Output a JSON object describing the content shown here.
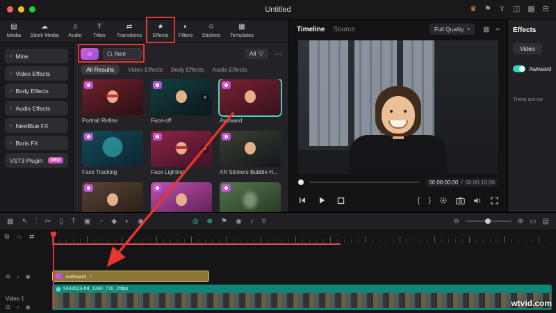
{
  "colors": {
    "accent": "#2ed9c3",
    "annotation": "#e8352c",
    "selection": "#45d7c6",
    "badge_pink": "#d553c8",
    "effect_clip": "#8c7634",
    "video_clip": "#0e8576"
  },
  "titlebar": {
    "title": "Untitled",
    "right_icons": [
      {
        "name": "upgrade-crown-icon",
        "glyph": "♛"
      },
      {
        "name": "flag-icon",
        "glyph": "⚑"
      },
      {
        "name": "export-icon",
        "glyph": "⇧"
      },
      {
        "name": "layout-icon",
        "glyph": "◫"
      },
      {
        "name": "media-grid-icon",
        "glyph": "▦"
      },
      {
        "name": "screen-record-icon",
        "glyph": "⊟"
      }
    ]
  },
  "ribbon": {
    "tabs": [
      {
        "label": "Media",
        "glyph": "▤"
      },
      {
        "label": "Stock Media",
        "glyph": "☁"
      },
      {
        "label": "Audio",
        "glyph": "♫"
      },
      {
        "label": "Titles",
        "glyph": "T"
      },
      {
        "label": "Transitions",
        "glyph": "⇄"
      },
      {
        "label": "Effects",
        "glyph": "★"
      },
      {
        "label": "Filters",
        "glyph": "◐"
      },
      {
        "label": "Stickers",
        "glyph": "☺"
      },
      {
        "label": "Templates",
        "glyph": "▦"
      }
    ]
  },
  "sidebar": {
    "chevron": "›",
    "items": [
      {
        "label": "Mine"
      },
      {
        "label": "Video Effects"
      },
      {
        "label": "Body Effects"
      },
      {
        "label": "Audio Effects"
      },
      {
        "label": "NewBlue FX"
      },
      {
        "label": "Boris FX"
      },
      {
        "label": "VST3 Plugin",
        "badge": "PRO"
      }
    ]
  },
  "browser": {
    "search": {
      "value": "face"
    },
    "all_filter": {
      "label": "All",
      "glyph": "▽"
    },
    "more_glyph": "⋯",
    "face_button_glyph": "☺",
    "plus_glyph": "+",
    "chips": [
      {
        "label": "All Results"
      },
      {
        "label": "Video Effects"
      },
      {
        "label": "Body Effects"
      },
      {
        "label": "Audio Effects"
      }
    ],
    "effects": [
      {
        "name": "Portrait Refine"
      },
      {
        "name": "Face-off"
      },
      {
        "name": "Awkward"
      },
      {
        "name": "Face Tracking"
      },
      {
        "name": "Face Lighting"
      },
      {
        "name": "AR Stickers Bubble H..."
      }
    ]
  },
  "preview": {
    "tab_timeline": "Timeline",
    "tab_source": "Source",
    "quality": "Full Quality",
    "caret": "▾",
    "grid_icon": "▦",
    "scope_icon": "≈",
    "current_time": "00:00:00:00",
    "time_separator": "/",
    "duration": "00:00:10:00",
    "mark_in": "{",
    "mark_out": "}"
  },
  "inspector": {
    "title": "Effects",
    "video_tab": "Video",
    "effect_name": "Awkward",
    "empty_text": "There are no"
  },
  "timeline": {
    "effect_clip_label": "Awkward",
    "video_clip_label": "5442623-hd_1280_720_25fps",
    "track_label": "Video 1",
    "heart_glyph": "♥",
    "tools": [
      {
        "name": "media-bin-icon",
        "glyph": "▦"
      },
      {
        "name": "pointer-tool-icon",
        "glyph": "↖"
      },
      {
        "name": "split-icon",
        "glyph": "✂"
      },
      {
        "name": "delete-icon",
        "glyph": "▯"
      },
      {
        "name": "text-icon",
        "glyph": "T"
      },
      {
        "name": "crop-icon",
        "glyph": "▣"
      },
      {
        "name": "speed-icon",
        "glyph": "◔"
      },
      {
        "name": "keyframe-icon",
        "glyph": "◆"
      },
      {
        "name": "color-icon",
        "glyph": "◐"
      },
      {
        "name": "mask-icon",
        "glyph": "◉"
      },
      {
        "name": "chroma-key-icon",
        "glyph": "◎"
      },
      {
        "name": "motion-track-icon",
        "glyph": "⊕"
      },
      {
        "name": "marker-icon",
        "glyph": "⚑"
      },
      {
        "name": "snapshot-icon",
        "glyph": "◉"
      },
      {
        "name": "voiceover-icon",
        "glyph": "♪"
      },
      {
        "name": "mixer-icon",
        "glyph": "≡"
      }
    ],
    "zoom": {
      "out": "⊖",
      "in": "⊕",
      "fit": "▭",
      "tracks": "▤"
    },
    "rail_icons": [
      {
        "name": "manage-tracks-icon",
        "glyph": "⊞"
      },
      {
        "name": "magnet-icon",
        "glyph": "∩"
      },
      {
        "name": "ripple-icon",
        "glyph": "⇄"
      }
    ],
    "track_icons": [
      {
        "name": "lock-icon",
        "glyph": "⊟"
      },
      {
        "name": "mute-icon",
        "glyph": "♪"
      },
      {
        "name": "hide-icon",
        "glyph": "◉"
      }
    ]
  },
  "watermark": "wtvid.com"
}
